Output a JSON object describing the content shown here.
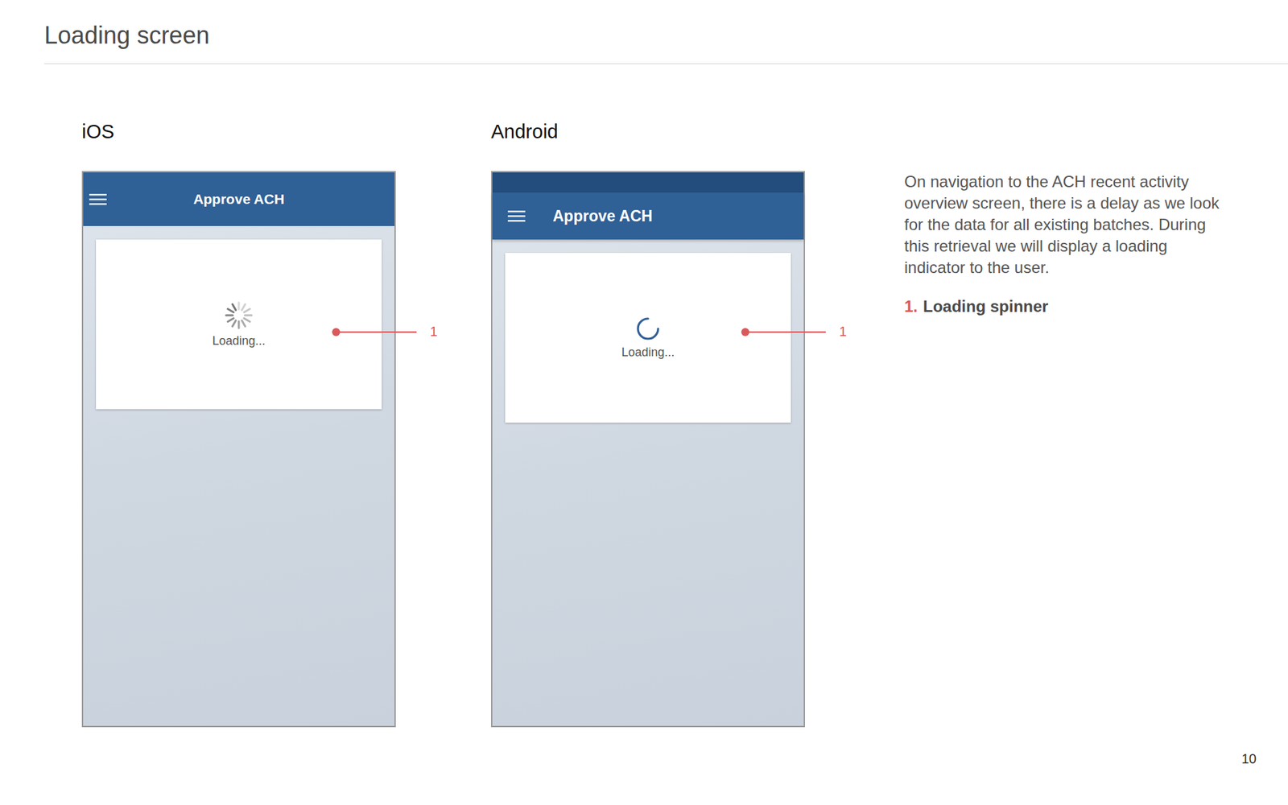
{
  "page": {
    "title": "Loading screen",
    "number": "10"
  },
  "mockups": [
    {
      "platform": "iOS",
      "kind": "ios",
      "app_bar_title": "Approve ACH",
      "loading_text": "Loading...",
      "callout": "1"
    },
    {
      "platform": "Android",
      "kind": "android",
      "app_bar_title": "Approve ACH",
      "loading_text": "Loading...",
      "callout": "1"
    }
  ],
  "description": {
    "text": "On navigation to the ACH recent activity overview screen, there is a delay as we look for the data for all existing batches. During this retrieval we will display a loading indicator to the user.",
    "legend": [
      {
        "number": "1.",
        "label": "Loading spinner"
      }
    ]
  }
}
